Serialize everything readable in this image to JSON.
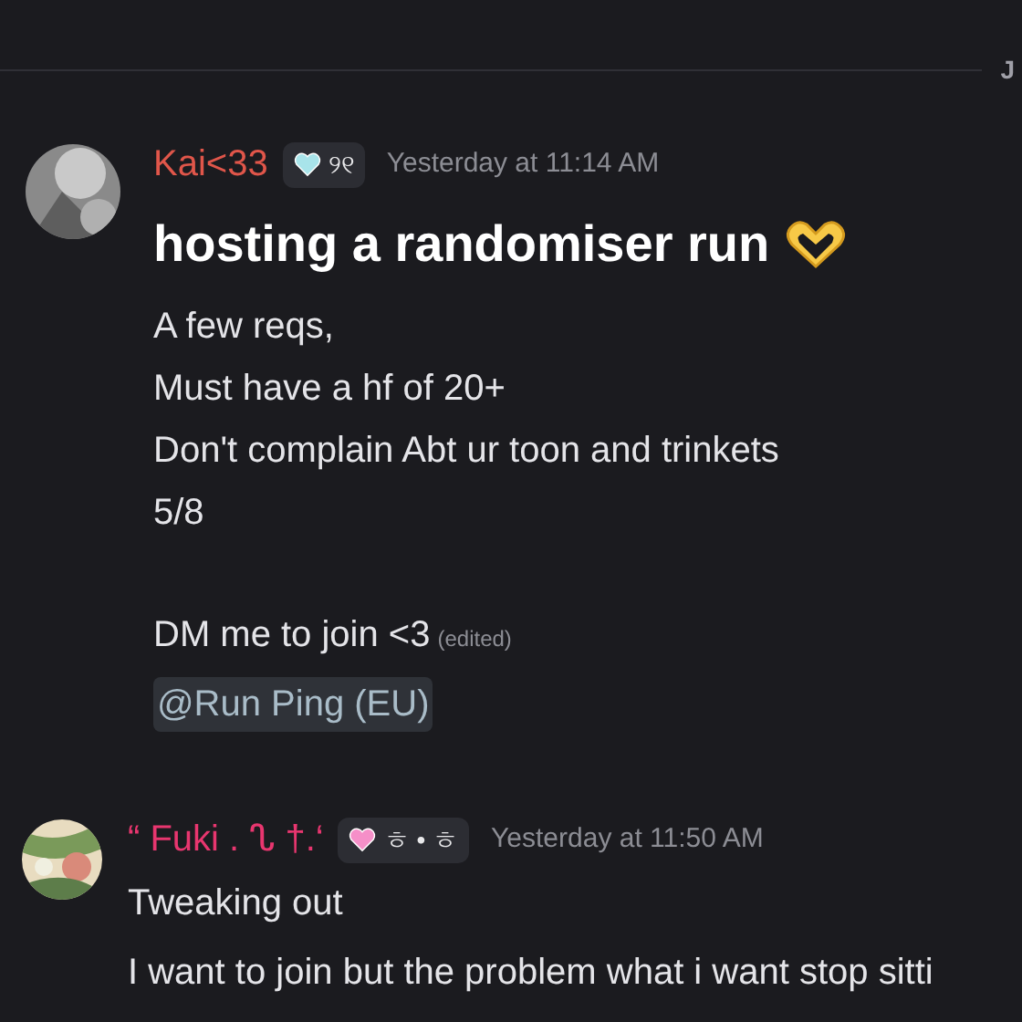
{
  "divider": {
    "date": "J"
  },
  "messages": [
    {
      "author": "Kai<33",
      "color": "#e0564a",
      "tag": {
        "color": "#a8e4ea",
        "text": "୨୧"
      },
      "time": "Yesterday at 11:14 AM",
      "heading": "hosting a randomiser run",
      "paragraphs": [
        [
          "A few reqs,",
          "Must have a hf of 20+",
          "Don't complain Abt ur toon and trinkets",
          "5/8"
        ],
        [
          "DM me to join <3"
        ]
      ],
      "edited": "(edited)",
      "mention": "@Run Ping (EU)",
      "avatar": {
        "kind": "picture"
      }
    },
    {
      "author": "“ Fuki .  ᔐ  †.‘",
      "color": "#e8366f",
      "tag": {
        "color": "#f58fc8",
        "text": "ㅎ • ㅎ"
      },
      "time": "Yesterday at 11:50 AM",
      "paragraphs": [
        [
          "Tweaking out",
          "I want to join but the problem what i want stop sitti"
        ]
      ],
      "avatar": {
        "kind": "picture"
      }
    }
  ]
}
